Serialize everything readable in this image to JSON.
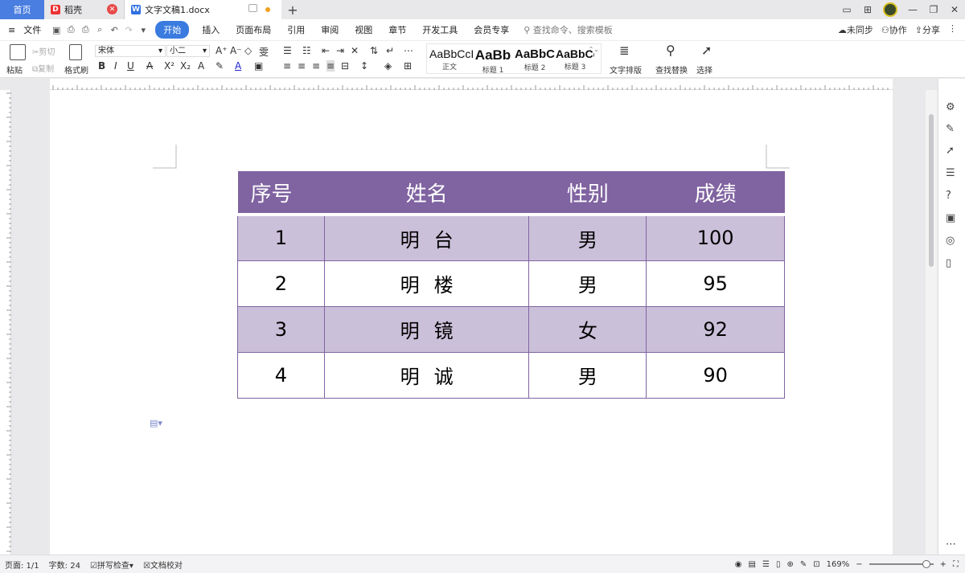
{
  "titlebar": {
    "home_tab": "首页",
    "tabs": [
      {
        "label": "稻壳",
        "icon": "daoke-icon"
      },
      {
        "label": "文字文稿1.docx",
        "icon": "wps-writer-icon"
      }
    ],
    "add_tab": "+"
  },
  "menubar": {
    "file": "文件",
    "items": [
      "开始",
      "插入",
      "页面布局",
      "引用",
      "审阅",
      "视图",
      "章节",
      "开发工具",
      "会员专享"
    ],
    "active": "开始",
    "search": "查找命令、搜索模板",
    "sync": "未同步",
    "collab": "协作",
    "share": "分享"
  },
  "ribbon": {
    "paste": "粘贴",
    "cut": "剪切",
    "copy": "复制",
    "format_painter": "格式刷",
    "font_name": "宋体",
    "font_size": "小二",
    "styles": [
      {
        "sample": "AaBbCcI",
        "label": "正文"
      },
      {
        "sample": "AaBb",
        "label": "标题 1"
      },
      {
        "sample": "AaBbC",
        "label": "标题 2"
      },
      {
        "sample": "AaBbCc",
        "label": "标题 3"
      }
    ],
    "text_layout": "文字排版",
    "find_replace": "查找替换",
    "select": "选择"
  },
  "table": {
    "headers": [
      "序号",
      "姓名",
      "性别",
      "成绩"
    ],
    "rows": [
      {
        "no": "1",
        "name": "明台",
        "gender": "男",
        "score": "100"
      },
      {
        "no": "2",
        "name": "明楼",
        "gender": "男",
        "score": "95"
      },
      {
        "no": "3",
        "name": "明镜",
        "gender": "女",
        "score": "92"
      },
      {
        "no": "4",
        "name": "明诚",
        "gender": "男",
        "score": "90"
      }
    ],
    "header_color": "#8063a1",
    "band_color": "#cbc0d9"
  },
  "statusbar": {
    "page": "页面: 1/1",
    "word_count": "字数: 24",
    "spell_check": "拼写检查",
    "doc_proof": "文档校对",
    "zoom": "169%"
  },
  "colors": {
    "accent": "#3a7be0",
    "home_tab": "#4a7ee0"
  }
}
